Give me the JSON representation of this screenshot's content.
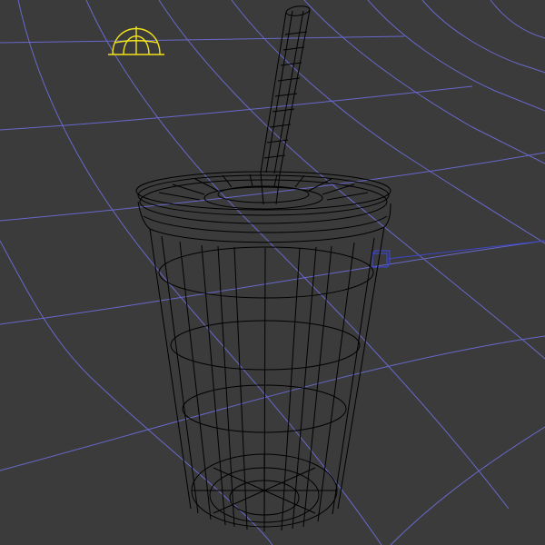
{
  "viewport": {
    "background_color": "#3b3b3b",
    "view": "perspective-wireframe"
  },
  "scene": {
    "backdrop": {
      "type": "curved-plane",
      "display": "wireframe",
      "wire_color": "#6d6ddc"
    },
    "objects": [
      {
        "name": "cup-with-lid-and-straw",
        "display": "wireframe",
        "wire_color": "#000000",
        "parts": [
          "cup",
          "lid",
          "straw"
        ]
      }
    ],
    "light": {
      "type": "skylight-dome",
      "icon": "dome-light-icon",
      "color": "#f2e21a"
    },
    "helper": {
      "type": "camera-target",
      "icon": "target-box-icon",
      "color": "#3c46c8"
    }
  }
}
